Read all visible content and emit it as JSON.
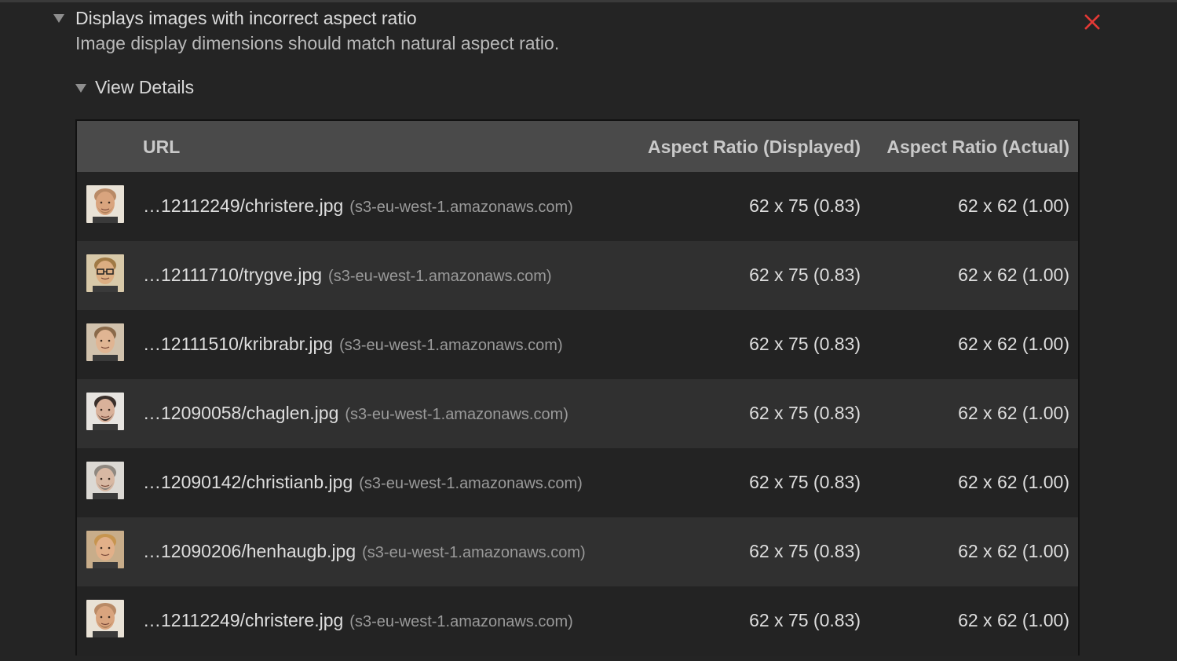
{
  "audit": {
    "title": "Displays images with incorrect aspect ratio",
    "description": "Image display dimensions should match natural aspect ratio.",
    "status_icon": "fail-x-icon",
    "status_color": "#e53935"
  },
  "details": {
    "label": "View Details"
  },
  "table": {
    "headers": {
      "url": "URL",
      "displayed": "Aspect Ratio (Displayed)",
      "actual": "Aspect Ratio (Actual)"
    },
    "rows": [
      {
        "path": "…12112249/christere.jpg",
        "host": "(s3-eu-west-1.amazonaws.com)",
        "displayed": "62 x 75 (0.83)",
        "actual": "62 x 62 (1.00)",
        "thumb": "avatar-bald-bearded"
      },
      {
        "path": "…12111710/trygve.jpg",
        "host": "(s3-eu-west-1.amazonaws.com)",
        "displayed": "62 x 75 (0.83)",
        "actual": "62 x 62 (1.00)",
        "thumb": "avatar-glasses-smiling"
      },
      {
        "path": "…12111510/kribrabr.jpg",
        "host": "(s3-eu-west-1.amazonaws.com)",
        "displayed": "62 x 75 (0.83)",
        "actual": "62 x 62 (1.00)",
        "thumb": "avatar-short-hair"
      },
      {
        "path": "…12090058/chaglen.jpg",
        "host": "(s3-eu-west-1.amazonaws.com)",
        "displayed": "62 x 75 (0.83)",
        "actual": "62 x 62 (1.00)",
        "thumb": "avatar-dark-beard"
      },
      {
        "path": "…12090142/christianb.jpg",
        "host": "(s3-eu-west-1.amazonaws.com)",
        "displayed": "62 x 75 (0.83)",
        "actual": "62 x 62 (1.00)",
        "thumb": "avatar-grey-beard"
      },
      {
        "path": "…12090206/henhaugb.jpg",
        "host": "(s3-eu-west-1.amazonaws.com)",
        "displayed": "62 x 75 (0.83)",
        "actual": "62 x 62 (1.00)",
        "thumb": "avatar-blond-smiling"
      },
      {
        "path": "…12112249/christere.jpg",
        "host": "(s3-eu-west-1.amazonaws.com)",
        "displayed": "62 x 75 (0.83)",
        "actual": "62 x 62 (1.00)",
        "thumb": "avatar-bald-bearded"
      }
    ]
  }
}
